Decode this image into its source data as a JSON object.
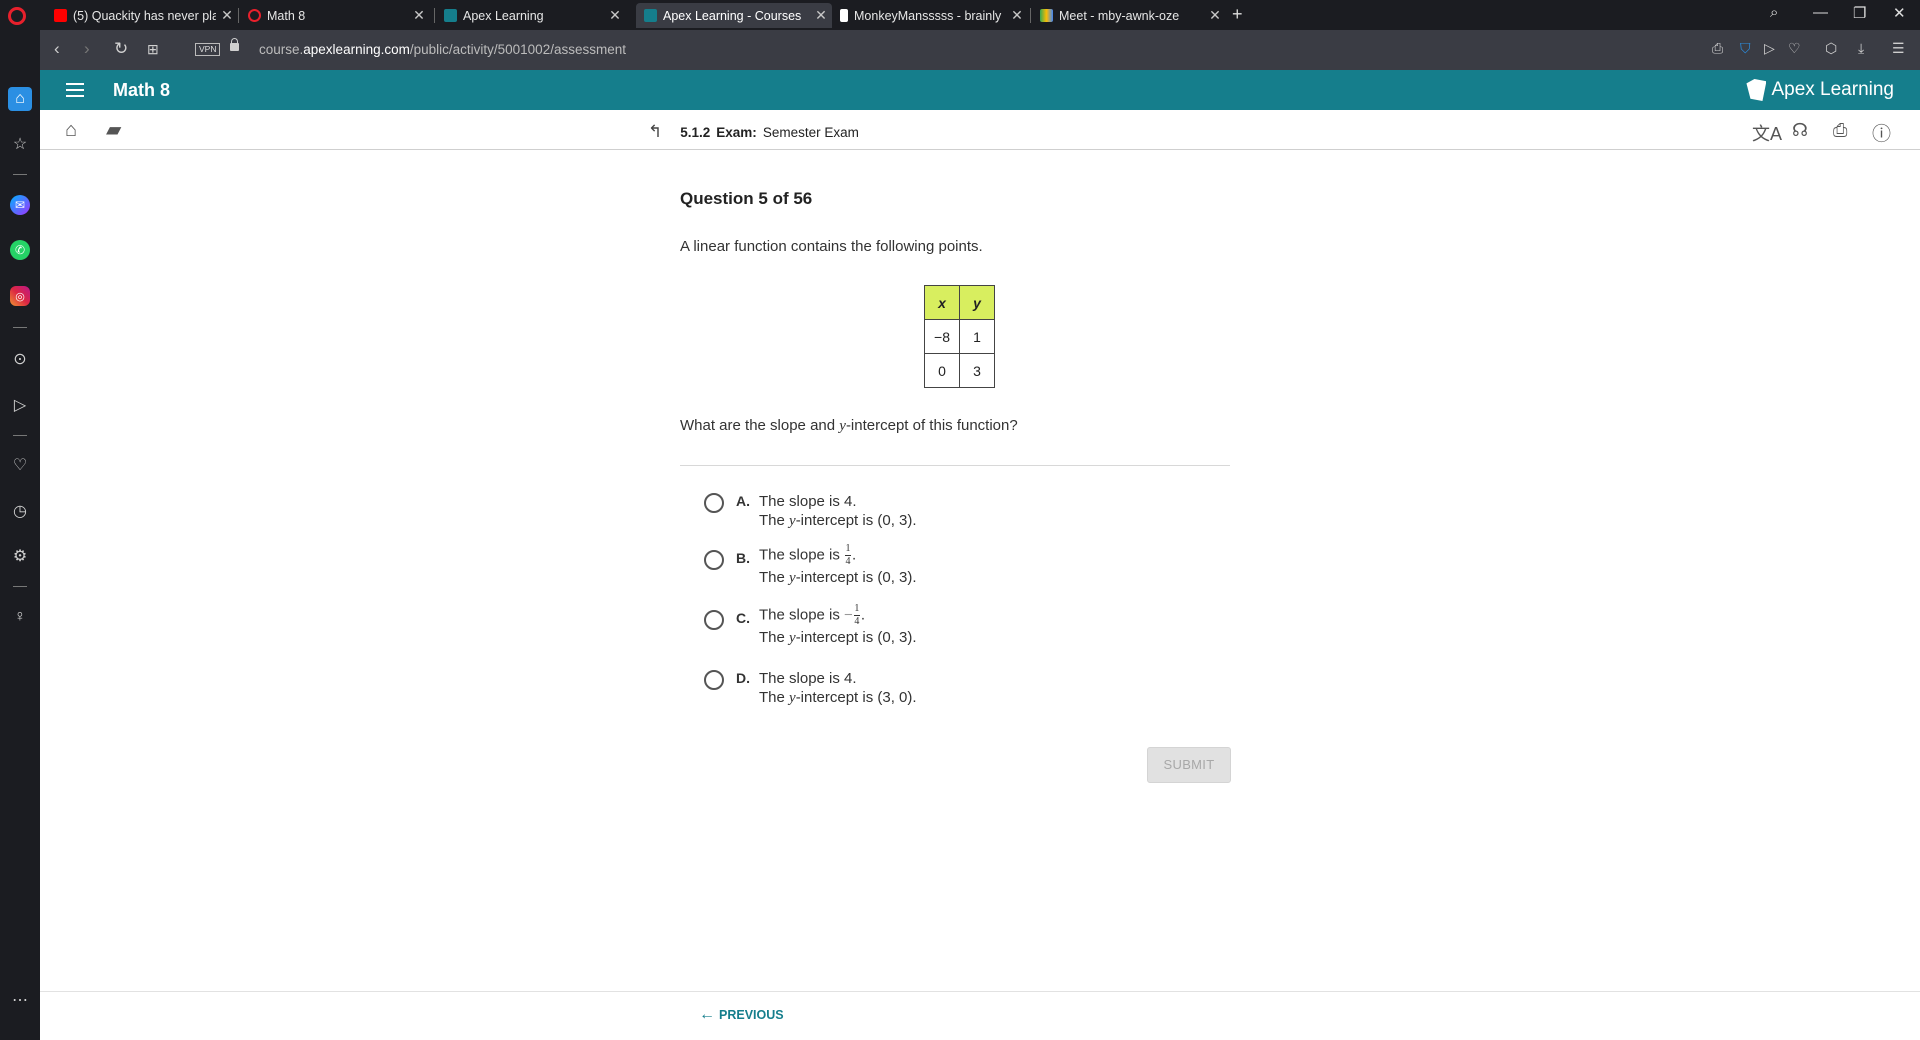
{
  "browser": {
    "tabs": [
      {
        "label": "(5) Quackity has never play",
        "favicon_color": "#ff0000",
        "active": false
      },
      {
        "label": "Math 8",
        "favicon_color": "#e8202c",
        "active": false
      },
      {
        "label": "Apex Learning",
        "favicon_color": "#157e8c",
        "active": false
      },
      {
        "label": "Apex Learning - Courses",
        "favicon_color": "#157e8c",
        "active": true
      },
      {
        "label": "MonkeyMansssss - brainly",
        "favicon_color": "#ffffff",
        "active": false
      },
      {
        "label": "Meet - mby-awnk-oze",
        "favicon_color": "#34a853",
        "active": false
      }
    ],
    "new_tab_glyph": "+",
    "vpn_label": "VPN",
    "url_prefix": "course.",
    "url_domain": "apexlearning.com",
    "url_path": "/public/activity/5001002/assessment"
  },
  "app": {
    "course_title": "Math 8",
    "brand": "Apex Learning",
    "exam_number": "5.1.2",
    "exam_label": "Exam:",
    "exam_title": "Semester Exam"
  },
  "question": {
    "title": "Question 5 of 56",
    "prompt": "A linear function contains the following points.",
    "table": {
      "headers": [
        "x",
        "y"
      ],
      "rows": [
        [
          "−8",
          "1"
        ],
        [
          "0",
          "3"
        ]
      ]
    },
    "ask_before": "What are the slope and ",
    "ask_var": "y",
    "ask_after": "-intercept of this function?",
    "options": [
      {
        "letter": "A.",
        "slope_text": "The slope is 4.",
        "intercept_pre": "The ",
        "intercept_var": "y",
        "intercept_post": "-intercept is (0, 3)."
      },
      {
        "letter": "B.",
        "slope_pre": "The slope is ",
        "slope_num": "1",
        "slope_den": "4",
        "slope_post": ".",
        "intercept_pre": "The ",
        "intercept_var": "y",
        "intercept_post": "-intercept is (0, 3)."
      },
      {
        "letter": "C.",
        "slope_pre": "The slope is ",
        "slope_sign": "−",
        "slope_num": "1",
        "slope_den": "4",
        "slope_post": ".",
        "intercept_pre": "The ",
        "intercept_var": "y",
        "intercept_post": "-intercept is (0, 3)."
      },
      {
        "letter": "D.",
        "slope_text": "The slope is 4.",
        "intercept_pre": "The ",
        "intercept_var": "y",
        "intercept_post": "-intercept is (3, 0)."
      }
    ],
    "submit_label": "SUBMIT"
  },
  "footer": {
    "previous_label": "PREVIOUS"
  },
  "colors": {
    "teal": "#157e8c",
    "table_header": "#d8ee5f"
  }
}
